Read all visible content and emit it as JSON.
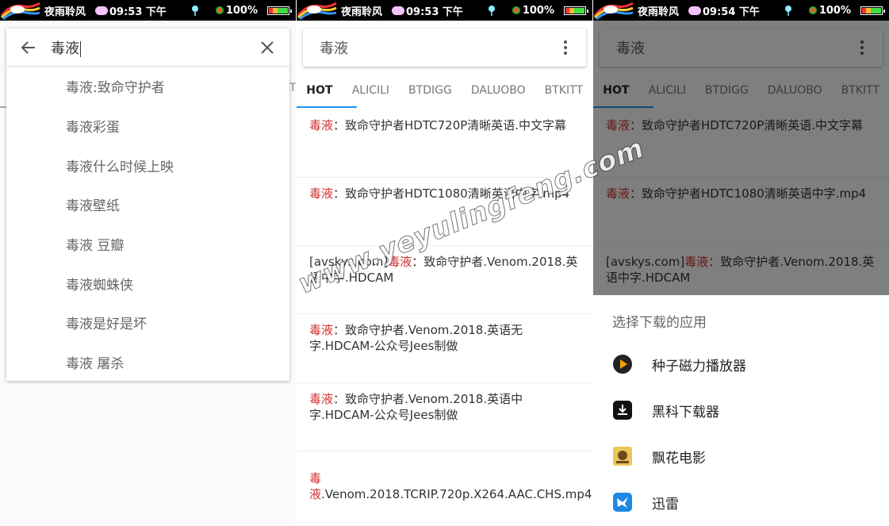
{
  "statusbar": [
    {
      "name": "夜雨聆风",
      "time": "09:53 下午",
      "battery": "100%"
    },
    {
      "name": "夜雨聆风",
      "time": "09:53 下午",
      "battery": "100%"
    },
    {
      "name": "夜雨聆风",
      "time": "09:54 下午",
      "battery": "100%"
    }
  ],
  "panel1": {
    "query": "毒液",
    "suggestions": [
      "毒液:致命守护者",
      "毒液彩蛋",
      "毒液什么时候上映",
      "毒液壁纸",
      "毒液 豆瓣",
      "毒液蜘蛛侠",
      "毒液是好是坏",
      "毒液 屠杀"
    ],
    "tab_hint": "T"
  },
  "panel2": {
    "title": "毒液",
    "tabs": [
      "HOT",
      "ALICILI",
      "BTDIGG",
      "DALUOBO",
      "BTKITT"
    ],
    "results": [
      {
        "pre": "",
        "hl": "毒液",
        "post": "：致命守护者HDTC720P清晰英语.中文字幕"
      },
      {
        "pre": "",
        "hl": "毒液",
        "post": "：致命守护者HDTC1080清晰英语中字.mp4"
      },
      {
        "pre": "[avskys.com]",
        "hl": "毒液",
        "post": "：致命守护者.Venom.2018.英语中字.HDCAM"
      },
      {
        "pre": "",
        "hl": "毒液",
        "post": "：致命守护者.Venom.2018.英语无字.HDCAM-公众号Jees制做"
      },
      {
        "pre": "",
        "hl": "毒液",
        "post": "：致命守护者.Venom.2018.英语中字.HDCAM-公众号Jees制做"
      },
      {
        "pre": "",
        "hl": "毒液",
        "post": ".Venom.2018.TCRIP.720p.X264.AAC.CHS.mp4"
      }
    ]
  },
  "panel3": {
    "title": "毒液",
    "tabs": [
      "HOT",
      "ALICILI",
      "BTDIGG",
      "DALUOBO",
      "BTKITT"
    ],
    "results": [
      {
        "pre": "",
        "hl": "毒液",
        "post": "：致命守护者HDTC720P清晰英语.中文字幕"
      },
      {
        "pre": "",
        "hl": "毒液",
        "post": "：致命守护者HDTC1080清晰英语中字.mp4"
      },
      {
        "pre": "[avskys.com]",
        "hl": "毒液",
        "post": "：致命守护者.Venom.2018.英语中字.HDCAM"
      }
    ],
    "sheet": {
      "title": "选择下载的应用",
      "apps": [
        {
          "label": "种子磁力播放器",
          "icon": "play-circle-icon"
        },
        {
          "label": "黑科下载器",
          "icon": "download-box-icon"
        },
        {
          "label": "飘花电影",
          "icon": "film-logo-icon"
        },
        {
          "label": "迅雷",
          "icon": "thunder-bird-icon"
        }
      ]
    }
  },
  "watermark": "www.yeyulingfeng.com",
  "colors": {
    "accent": "#2196f3",
    "highlight": "#d32f2f",
    "statusbar": "#000000"
  }
}
